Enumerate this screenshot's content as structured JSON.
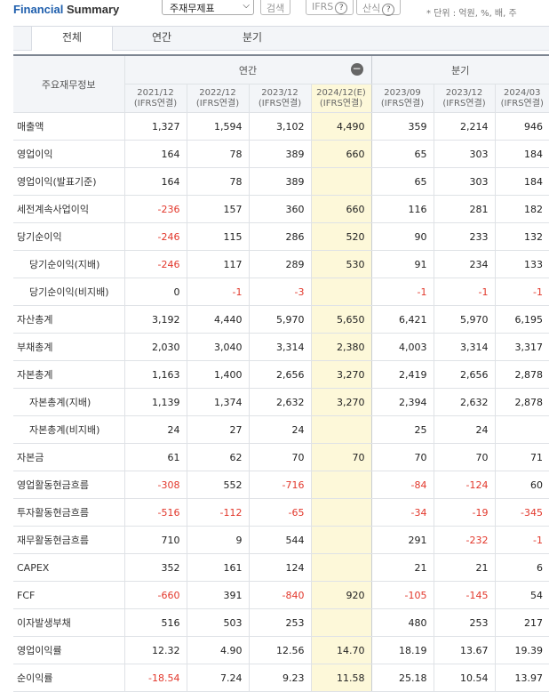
{
  "header": {
    "title_part1": "Financial",
    "title_part2": "Summary",
    "select_value": "주재무제표",
    "search_label": "검색",
    "ifrs_label": "IFRS",
    "formula_label": "산식",
    "unit_text": "* 단위 : 억원, %, 배, 주"
  },
  "tabs": [
    "전체",
    "연간",
    "분기"
  ],
  "table": {
    "corner_label": "주요재무정보",
    "group_annual": "연간",
    "group_quarter": "분기",
    "columns": [
      {
        "period": "2021/12",
        "basis": "(IFRS연결)"
      },
      {
        "period": "2022/12",
        "basis": "(IFRS연결)"
      },
      {
        "period": "2023/12",
        "basis": "(IFRS연결)"
      },
      {
        "period": "2024/12(E)",
        "basis": "(IFRS연결)"
      },
      {
        "period": "2023/09",
        "basis": "(IFRS연결)"
      },
      {
        "period": "2023/12",
        "basis": "(IFRS연결)"
      },
      {
        "period": "2024/03",
        "basis": "(IFRS연결)"
      }
    ],
    "rows": [
      {
        "label": "매출액",
        "sub": false,
        "values": [
          "1,327",
          "1,594",
          "3,102",
          "4,490",
          "359",
          "2,214",
          "946"
        ]
      },
      {
        "label": "영업이익",
        "sub": false,
        "values": [
          "164",
          "78",
          "389",
          "660",
          "65",
          "303",
          "184"
        ]
      },
      {
        "label": "영업이익(발표기준)",
        "sub": false,
        "values": [
          "164",
          "78",
          "389",
          "",
          "65",
          "303",
          "184"
        ]
      },
      {
        "label": "세전계속사업이익",
        "sub": false,
        "values": [
          "-236",
          "157",
          "360",
          "660",
          "116",
          "281",
          "182"
        ]
      },
      {
        "label": "당기순이익",
        "sub": false,
        "values": [
          "-246",
          "115",
          "286",
          "520",
          "90",
          "233",
          "132"
        ]
      },
      {
        "label": "당기순이익(지배)",
        "sub": true,
        "values": [
          "-246",
          "117",
          "289",
          "530",
          "91",
          "234",
          "133"
        ]
      },
      {
        "label": "당기순이익(비지배)",
        "sub": true,
        "values": [
          "0",
          "-1",
          "-3",
          "",
          "-1",
          "-1",
          "-1"
        ]
      },
      {
        "label": "자산총계",
        "sub": false,
        "values": [
          "3,192",
          "4,440",
          "5,970",
          "5,650",
          "6,421",
          "5,970",
          "6,195"
        ]
      },
      {
        "label": "부채총계",
        "sub": false,
        "values": [
          "2,030",
          "3,040",
          "3,314",
          "2,380",
          "4,003",
          "3,314",
          "3,317"
        ]
      },
      {
        "label": "자본총계",
        "sub": false,
        "values": [
          "1,163",
          "1,400",
          "2,656",
          "3,270",
          "2,419",
          "2,656",
          "2,878"
        ]
      },
      {
        "label": "자본총계(지배)",
        "sub": true,
        "values": [
          "1,139",
          "1,374",
          "2,632",
          "3,270",
          "2,394",
          "2,632",
          "2,878"
        ]
      },
      {
        "label": "자본총계(비지배)",
        "sub": true,
        "values": [
          "24",
          "27",
          "24",
          "",
          "25",
          "24",
          ""
        ]
      },
      {
        "label": "자본금",
        "sub": false,
        "values": [
          "61",
          "62",
          "70",
          "70",
          "70",
          "70",
          "71"
        ]
      },
      {
        "label": "영업활동현금흐름",
        "sub": false,
        "values": [
          "-308",
          "552",
          "-716",
          "",
          "-84",
          "-124",
          "60"
        ]
      },
      {
        "label": "투자활동현금흐름",
        "sub": false,
        "values": [
          "-516",
          "-112",
          "-65",
          "",
          "-34",
          "-19",
          "-345"
        ]
      },
      {
        "label": "재무활동현금흐름",
        "sub": false,
        "values": [
          "710",
          "9",
          "544",
          "",
          "291",
          "-232",
          "-1"
        ]
      },
      {
        "label": "CAPEX",
        "sub": false,
        "values": [
          "352",
          "161",
          "124",
          "",
          "21",
          "21",
          "6"
        ]
      },
      {
        "label": "FCF",
        "sub": false,
        "values": [
          "-660",
          "391",
          "-840",
          "920",
          "-105",
          "-145",
          "54"
        ]
      },
      {
        "label": "이자발생부채",
        "sub": false,
        "values": [
          "516",
          "503",
          "253",
          "",
          "480",
          "253",
          "217"
        ]
      },
      {
        "label": "영업이익률",
        "sub": false,
        "values": [
          "12.32",
          "4.90",
          "12.56",
          "14.70",
          "18.19",
          "13.67",
          "19.39"
        ]
      },
      {
        "label": "순이익률",
        "sub": false,
        "values": [
          "-18.54",
          "7.24",
          "9.23",
          "11.58",
          "25.18",
          "10.54",
          "13.97"
        ]
      }
    ]
  }
}
